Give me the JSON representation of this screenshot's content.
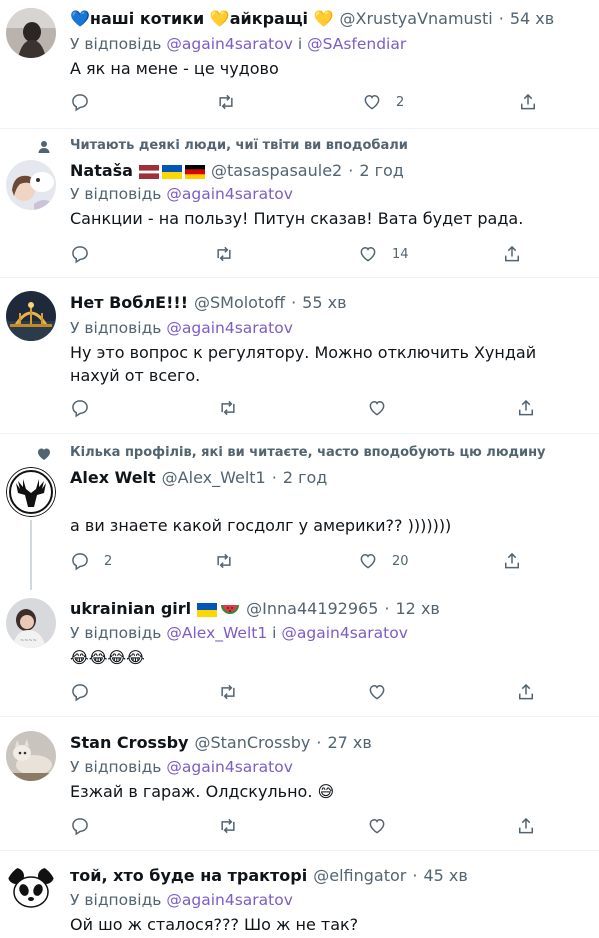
{
  "reply_prefix": "У відповідь",
  "reply_joiner": "і",
  "tweets": [
    {
      "name": "💙нaші котики 💛айкращі 💛",
      "handle": "@XrustyaVnamusti",
      "time": "54 хв",
      "mentions": [
        "@again4saratov",
        "@SAsfendiar"
      ],
      "text": "А як на мене - це чудово",
      "likes": "2",
      "replies": "",
      "retweets": ""
    },
    {
      "social_context": "Читають деякі люди, чиї твіти ви вподобали",
      "name": "Nataša",
      "handle": "@tasaspasaule2",
      "time": "2 год",
      "mentions": [
        "@again4saratov"
      ],
      "text": "Санкции - на пользу! Питун сказав! Вата будет рада.",
      "likes": "14",
      "replies": "",
      "retweets": ""
    },
    {
      "name": "Нет ВоблЕ!!!",
      "handle": "@SMolotoff",
      "time": "55 хв",
      "mentions": [
        "@again4saratov"
      ],
      "text": "Ну это вопрос к регулятору. Можно отключить Хундай нахуй от всего.",
      "likes": "",
      "replies": "",
      "retweets": ""
    },
    {
      "social_context": "Кількa профілів, які ви читаєте, часто вподобують цю людину",
      "name": "Alex Welt",
      "handle": "@Alex_Welt1",
      "time": "2 год",
      "mentions": [],
      "text": "а ви знаете какой госдолг у америки?? )))))))",
      "likes": "20",
      "replies": "2",
      "retweets": ""
    },
    {
      "name": "ukrainian girl",
      "handle": "@Inna44192965",
      "time": "12 хв",
      "mentions": [
        "@Alex_Welt1",
        "@again4saratov"
      ],
      "text": "😂😂😂😂",
      "likes": "",
      "replies": "",
      "retweets": ""
    },
    {
      "name": "Stan Crossby",
      "handle": "@StanCrossby",
      "time": "27 хв",
      "mentions": [
        "@again4saratov"
      ],
      "text": "Езжай в гараж. Олдскульно. 😅",
      "likes": "",
      "replies": "",
      "retweets": ""
    },
    {
      "name": "той, хто буде на тракторі",
      "handle": "@elfingator",
      "time": "45 хв",
      "mentions": [
        "@again4saratov"
      ],
      "text": "Ой шо ж сталося??? Шо ж не так?",
      "likes": "",
      "replies": "",
      "retweets": ""
    }
  ],
  "colors": {
    "mention": "#7e5cc7",
    "secondary": "#536471",
    "divider": "#eff3f4"
  },
  "icons": [
    "reply-icon",
    "retweet-icon",
    "like-icon",
    "share-icon",
    "person-icon",
    "heart-filled-icon"
  ]
}
